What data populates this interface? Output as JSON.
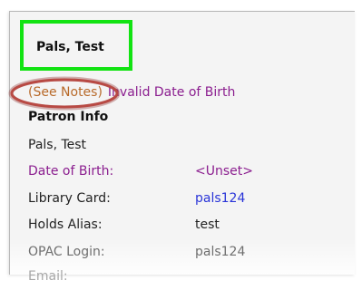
{
  "patron": {
    "header_name": "Pals, Test",
    "display_name": "Pals, Test"
  },
  "alerts": {
    "see_notes": "(See Notes)",
    "invalid_dob": "Invalid Date of Birth"
  },
  "section": {
    "title": "Patron Info"
  },
  "fields": [
    {
      "label": "Date of Birth:",
      "value": "<Unset>"
    },
    {
      "label": "Library Card:",
      "value": "pals124"
    },
    {
      "label": "Holds Alias:",
      "value": "test"
    },
    {
      "label": "OPAC Login:",
      "value": "pals124"
    },
    {
      "label": "Email:",
      "value": ""
    }
  ],
  "colors": {
    "header_highlight": "#12e312",
    "callout_ellipse": "#b84a44",
    "alert_purple": "#8b1e8f",
    "link_blue": "#2a35d8"
  }
}
